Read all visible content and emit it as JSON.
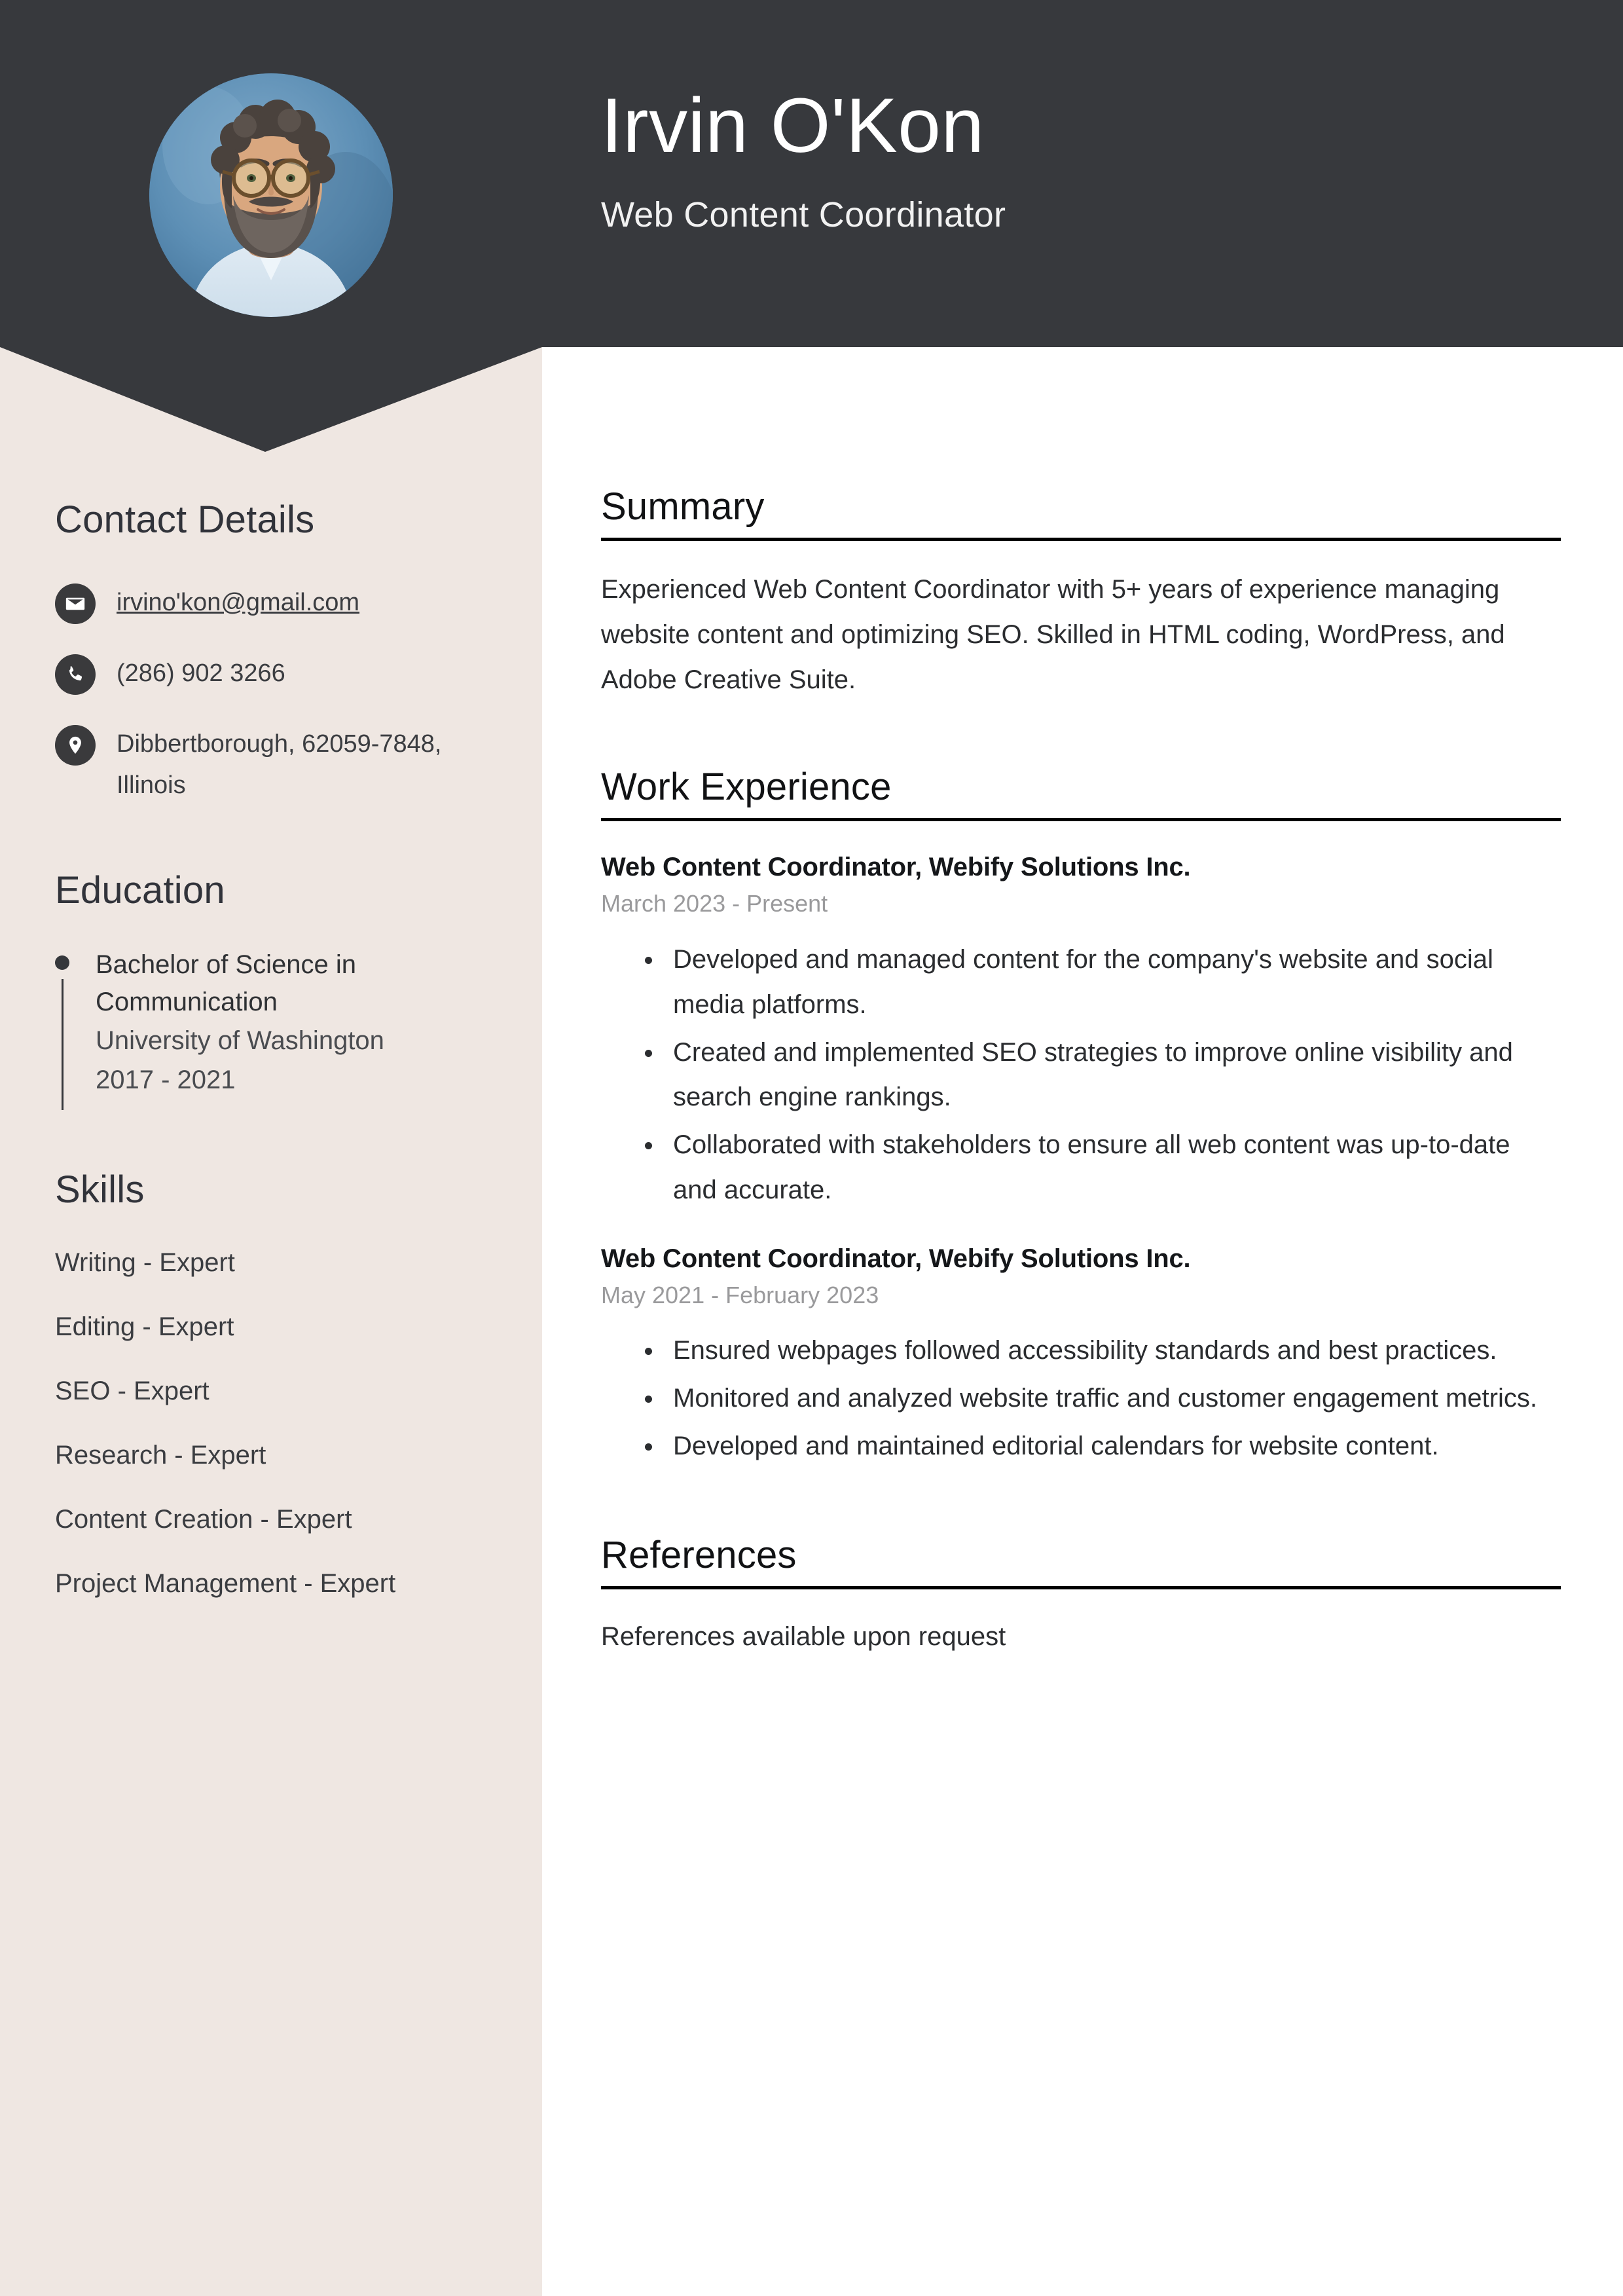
{
  "header": {
    "name": "Irvin O'Kon",
    "job_title": "Web Content Coordinator",
    "avatar_alt": "profile-photo",
    "background_color": "#37393D"
  },
  "sidebar": {
    "background_color": "#EFE7E2",
    "contact": {
      "heading": "Contact Details",
      "items": [
        {
          "icon": "envelope-icon",
          "value": "irvino'kon@gmail.com",
          "is_link": true
        },
        {
          "icon": "phone-icon",
          "value": "(286) 902 3266",
          "is_link": false
        },
        {
          "icon": "location-pin-icon",
          "value": "Dibbertborough, 62059-7848, Illinois",
          "is_link": false
        }
      ]
    },
    "education": {
      "heading": "Education",
      "entries": [
        {
          "degree": "Bachelor of Science in Communication",
          "school": "University of Washington",
          "years": "2017 - 2021"
        }
      ]
    },
    "skills": {
      "heading": "Skills",
      "items": [
        "Writing - Expert",
        "Editing - Expert",
        "SEO - Expert",
        "Research - Expert",
        "Content Creation - Expert",
        "Project Management - Expert"
      ]
    }
  },
  "main": {
    "summary": {
      "heading": "Summary",
      "text": "Experienced Web Content Coordinator with 5+ years of experience managing website content and optimizing SEO. Skilled in HTML coding, WordPress, and Adobe Creative Suite."
    },
    "work_experience": {
      "heading": "Work Experience",
      "jobs": [
        {
          "role": "Web Content Coordinator, Webify Solutions Inc.",
          "dates": "March 2023 - Present",
          "bullets": [
            "Developed and managed content for the company's website and social media platforms.",
            "Created and implemented SEO strategies to improve online visibility and search engine rankings.",
            "Collaborated with stakeholders to ensure all web content was up-to-date and accurate."
          ]
        },
        {
          "role": "Web Content Coordinator, Webify Solutions Inc.",
          "dates": "May 2021 - February 2023",
          "bullets": [
            "Ensured webpages followed accessibility standards and best practices.",
            "Monitored and analyzed website traffic and customer engagement metrics.",
            "Developed and maintained editorial calendars for website content."
          ]
        }
      ]
    },
    "references": {
      "heading": "References",
      "text": "References available upon request"
    }
  },
  "colors": {
    "header_dark": "#37393D",
    "sidebar_beige": "#EFE7E2",
    "icon_circle": "#3A3A3C",
    "body_text": "#2b2d30",
    "muted_text": "#9a9a9c",
    "rule": "#000000"
  }
}
